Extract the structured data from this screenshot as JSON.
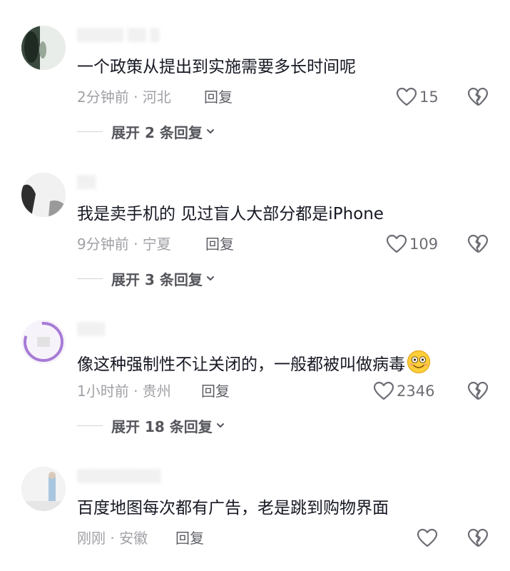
{
  "comments": [
    {
      "text": "一个政策从提出到实施需要多长时间呢",
      "meta": "2分钟前 · 河北",
      "reply_label": "回复",
      "likes": "15",
      "expand_label": "展开 2 条回复"
    },
    {
      "text": "我是卖手机的 见过盲人大部分都是iPhone",
      "meta": "9分钟前 · 宁夏",
      "reply_label": "回复",
      "likes": "109",
      "expand_label": "展开 3 条回复"
    },
    {
      "text": "像这种强制性不让关闭的，一般都被叫做病毒",
      "meta": "1小时前 · 贵州",
      "reply_label": "回复",
      "likes": "2346",
      "expand_label": "展开 18 条回复",
      "emoji": "smiling-face-emoji"
    },
    {
      "text": "百度地图每次都有广告，老是跳到购物界面",
      "meta": "刚刚 · 安徽",
      "reply_label": "回复",
      "likes": ""
    }
  ],
  "icons": {
    "like": "heart-outline-icon",
    "dislike": "broken-heart-icon",
    "expand": "chevron-down-icon"
  },
  "colors": {
    "text": "#161823",
    "meta": "#a0a0a6",
    "icon": "#6d6e75"
  }
}
